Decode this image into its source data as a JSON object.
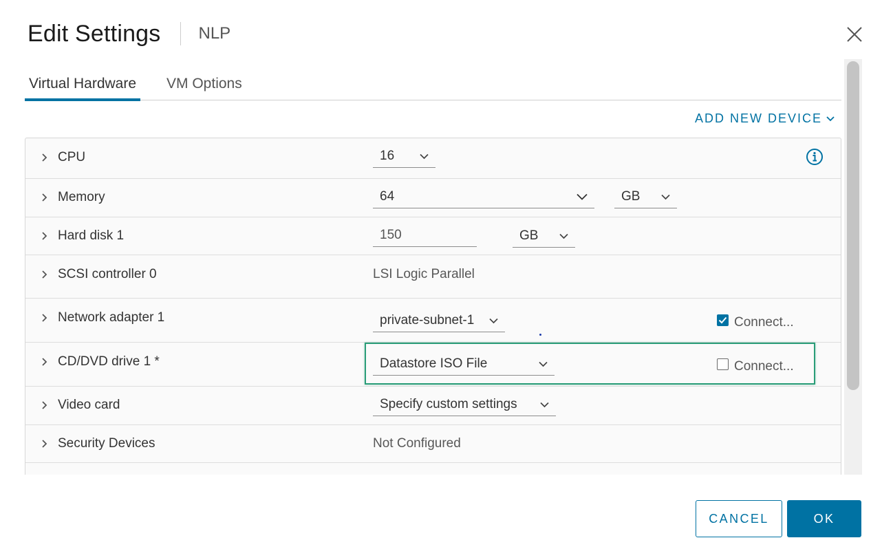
{
  "dialog": {
    "title": "Edit Settings",
    "subtitle": "NLP"
  },
  "tabs": [
    {
      "label": "Virtual Hardware",
      "active": true
    },
    {
      "label": "VM Options",
      "active": false
    }
  ],
  "add_device_label": "ADD NEW DEVICE",
  "rows": {
    "cpu": {
      "label": "CPU",
      "value": "16"
    },
    "memory": {
      "label": "Memory",
      "value": "64",
      "unit": "GB"
    },
    "hard_disk": {
      "label": "Hard disk 1",
      "value": "150",
      "unit": "GB"
    },
    "scsi": {
      "label": "SCSI controller 0",
      "value": "LSI Logic Parallel"
    },
    "network": {
      "label": "Network adapter 1",
      "value": "private-subnet-1",
      "connect_label": "Connect...",
      "connected": true
    },
    "cddvd": {
      "label": "CD/DVD drive 1 *",
      "value": "Datastore ISO File",
      "connect_label": "Connect...",
      "connected": false
    },
    "video": {
      "label": "Video card",
      "value": "Specify custom settings"
    },
    "security": {
      "label": "Security Devices",
      "value": "Not Configured"
    }
  },
  "buttons": {
    "cancel": "CANCEL",
    "ok": "OK"
  },
  "colors": {
    "accent": "#0072a3",
    "highlight": "#2a9d78"
  }
}
